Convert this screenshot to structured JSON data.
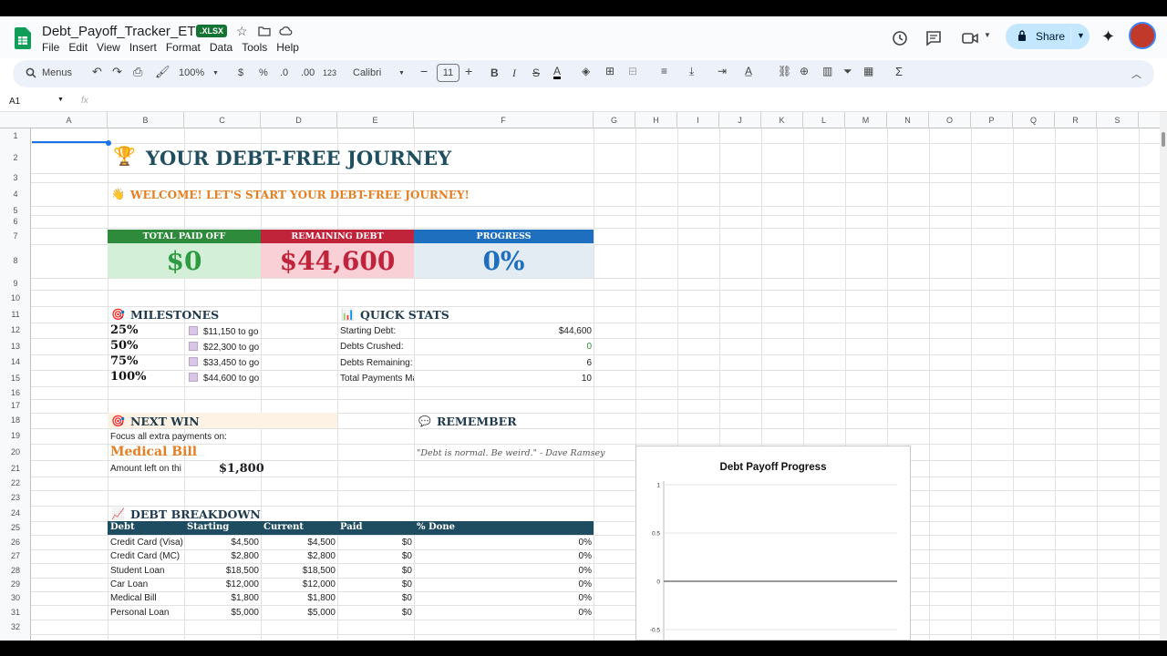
{
  "doc": {
    "title": "Debt_Payoff_Tracker_ETSY",
    "badge": ".XLSX"
  },
  "menu": [
    "File",
    "Edit",
    "View",
    "Insert",
    "Format",
    "Data",
    "Tools",
    "Help"
  ],
  "share": {
    "label": "Share"
  },
  "toolbar": {
    "search": "Menus",
    "zoom": "100%",
    "currency": "$",
    "percent": "%",
    "dec_less": ".0",
    "dec_more": ".00",
    "number_format": "123",
    "font": "Calibri",
    "font_size": "11"
  },
  "formula_bar": {
    "cell_ref": "A1",
    "fx": "fx"
  },
  "columns": [
    "A",
    "B",
    "C",
    "D",
    "E",
    "F",
    "G",
    "H",
    "I",
    "J",
    "K",
    "L",
    "M",
    "N",
    "O",
    "P",
    "Q",
    "R",
    "S"
  ],
  "rows": [
    "1",
    "2",
    "3",
    "4",
    "5",
    "6",
    "7",
    "8",
    "9",
    "10",
    "11",
    "12",
    "13",
    "14",
    "15",
    "16",
    "17",
    "18",
    "19",
    "20",
    "21",
    "22",
    "23",
    "24",
    "25",
    "26",
    "27",
    "28",
    "29",
    "30",
    "31",
    "32"
  ],
  "sheet": {
    "title": "YOUR DEBT-FREE JOURNEY",
    "welcome": "WELCOME! LET'S START YOUR DEBT-FREE JOURNEY!",
    "kpis": [
      {
        "label": "TOTAL PAID OFF",
        "value": "$0",
        "head_color": "#2e8b3c",
        "bg": "#d4efd8",
        "fg": "#2e9b42"
      },
      {
        "label": "REMAINING DEBT",
        "value": "$44,600",
        "head_color": "#c0243b",
        "bg": "#f8d0d6",
        "fg": "#c0243b"
      },
      {
        "label": "PROGRESS",
        "value": "0%",
        "head_color": "#1f6fbf",
        "bg": "#e3ecf3",
        "fg": "#1f6fbf"
      }
    ],
    "milestones": {
      "title": "MILESTONES",
      "items": [
        {
          "pct": "25%",
          "text": "$11,150 to go"
        },
        {
          "pct": "50%",
          "text": "$22,300 to go"
        },
        {
          "pct": "75%",
          "text": "$33,450 to go"
        },
        {
          "pct": "100%",
          "text": "$44,600 to go"
        }
      ]
    },
    "quick_stats": {
      "title": "QUICK STATS",
      "items": [
        {
          "label": "Starting Debt:",
          "value": "$44,600",
          "color": "#202124"
        },
        {
          "label": "Debts Crushed:",
          "value": "0",
          "color": "#2e8b3c"
        },
        {
          "label": "Debts Remaining:",
          "value": "6",
          "color": "#202124"
        },
        {
          "label": "Total Payments Ma",
          "value": "10",
          "color": "#202124"
        }
      ]
    },
    "next_win": {
      "title": "NEXT WIN",
      "focus": "Focus all extra payments on:",
      "debt": "Medical Bill",
      "amount_label": "Amount left on thi",
      "amount": "$1,800"
    },
    "remember": {
      "title": "REMEMBER",
      "quote": "\"Debt is normal. Be weird.\" - Dave Ramsey"
    },
    "breakdown": {
      "title": "DEBT BREAKDOWN",
      "headers": [
        "Debt",
        "Starting",
        "Current",
        "Paid",
        "% Done"
      ],
      "rows": [
        [
          "Credit Card (Visa)",
          "$4,500",
          "$4,500",
          "$0",
          "0%"
        ],
        [
          "Credit Card (MC)",
          "$2,800",
          "$2,800",
          "$0",
          "0%"
        ],
        [
          "Student Loan",
          "$18,500",
          "$18,500",
          "$0",
          "0%"
        ],
        [
          "Car Loan",
          "$12,000",
          "$12,000",
          "$0",
          "0%"
        ],
        [
          "Medical Bill",
          "$1,800",
          "$1,800",
          "$0",
          "0%"
        ],
        [
          "Personal Loan",
          "$5,000",
          "$5,000",
          "$0",
          "0%"
        ]
      ]
    }
  },
  "chart_data": {
    "type": "line",
    "title": "Debt Payoff Progress",
    "xlabel": "",
    "ylabel": "",
    "ylim": [
      -0.5,
      1
    ],
    "yticks": [
      "1",
      "0.5",
      "0",
      "-0.5"
    ],
    "series": [
      {
        "values": [
          0,
          0
        ]
      }
    ]
  }
}
